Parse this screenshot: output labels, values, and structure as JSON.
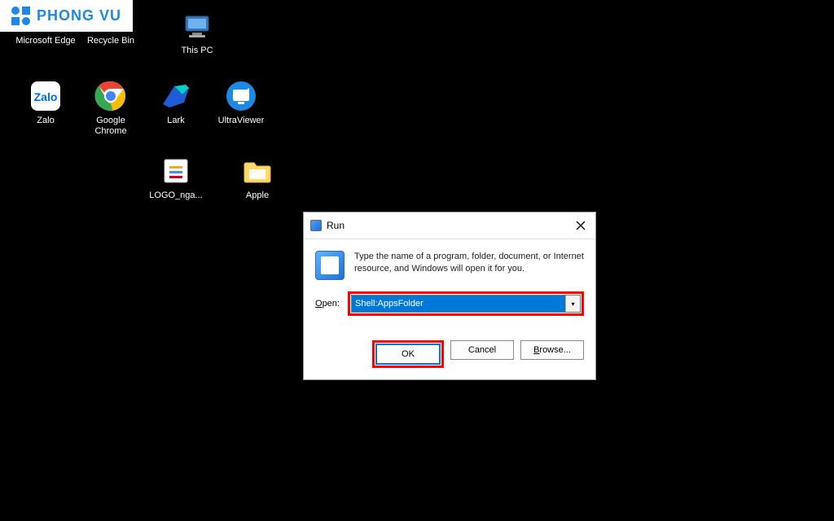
{
  "overlay": {
    "brand": "PHONG VU"
  },
  "desktop": {
    "icons": [
      {
        "name": "edge",
        "label": "Microsoft Edge"
      },
      {
        "name": "recycle",
        "label": "Recycle Bin"
      },
      {
        "name": "thispc",
        "label": "This PC"
      },
      {
        "name": "zalo",
        "label": "Zalo"
      },
      {
        "name": "chrome",
        "label": "Google Chrome"
      },
      {
        "name": "lark",
        "label": "Lark"
      },
      {
        "name": "ultraviewer",
        "label": "UltraViewer"
      },
      {
        "name": "logonga",
        "label": "LOGO_nga..."
      },
      {
        "name": "apple",
        "label": "Apple"
      }
    ]
  },
  "run": {
    "title": "Run",
    "description": "Type the name of a program, folder, document, or Internet resource, and Windows will open it for you.",
    "open_label": "Open:",
    "command": "Shell:AppsFolder",
    "buttons": {
      "ok": "OK",
      "cancel": "Cancel",
      "browse": "Browse..."
    }
  }
}
